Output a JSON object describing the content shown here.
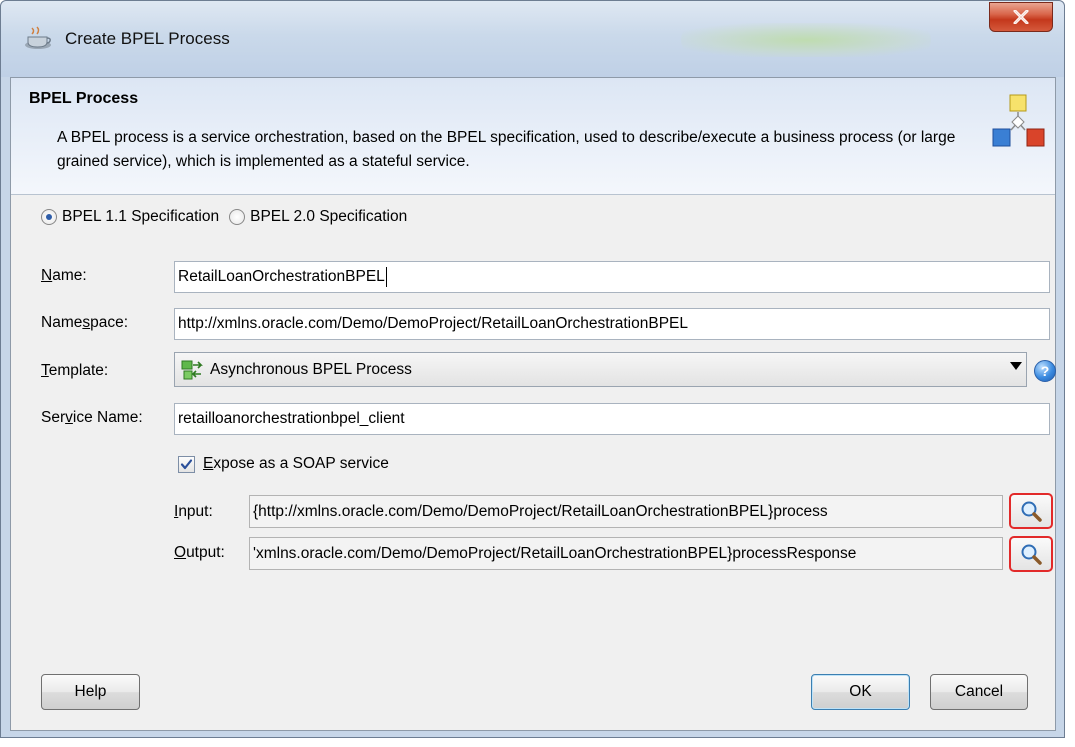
{
  "window": {
    "title": "Create BPEL Process"
  },
  "header": {
    "title": "BPEL Process",
    "description": "A BPEL process is a service orchestration, based on the BPEL specification, used to describe/execute a business process (or large grained service), which is implemented as a stateful service."
  },
  "spec_options": [
    {
      "label": "BPEL 1.1 Specification",
      "selected": true
    },
    {
      "label": "BPEL 2.0 Specification",
      "selected": false
    }
  ],
  "form": {
    "name_label_pre": "",
    "name_label_mnemonic": "N",
    "name_label_post": "ame:",
    "name_value": "RetailLoanOrchestrationBPEL",
    "namespace_label_pre": "Name",
    "namespace_label_mnemonic": "s",
    "namespace_label_post": "pace:",
    "namespace_value": "http://xmlns.oracle.com/Demo/DemoProject/RetailLoanOrchestrationBPEL",
    "template_label_pre": "",
    "template_label_mnemonic": "T",
    "template_label_post": "emplate:",
    "template_value": "Asynchronous BPEL Process",
    "service_name_label_pre": "Ser",
    "service_name_label_mnemonic": "v",
    "service_name_label_post": "ice Name:",
    "service_name_value": "retailloanorchestrationbpel_client",
    "expose_soap_pre": "",
    "expose_soap_mnemonic": "E",
    "expose_soap_post": "xpose as a SOAP service",
    "expose_soap_checked": true,
    "input_label_pre": "",
    "input_label_mnemonic": "I",
    "input_label_post": "nput:",
    "input_value": "{http://xmlns.oracle.com/Demo/DemoProject/RetailLoanOrchestrationBPEL}process",
    "output_label_pre": "",
    "output_label_mnemonic": "O",
    "output_label_post": "utput:",
    "output_value": "'xmlns.oracle.com/Demo/DemoProject/RetailLoanOrchestrationBPEL}processResponse"
  },
  "icons": {
    "app": "coffee-cup-icon",
    "bpel": "bpel-process-icon",
    "template": "async-process-icon",
    "help": "help-icon",
    "search": "search-icon",
    "close": "close-icon"
  },
  "buttons": {
    "help": "Help",
    "ok": "OK",
    "cancel": "Cancel"
  },
  "colors": {
    "highlight": "#e22a2a",
    "radio_dot": "#2d5ca8",
    "header_bg": "#dce6f4"
  }
}
